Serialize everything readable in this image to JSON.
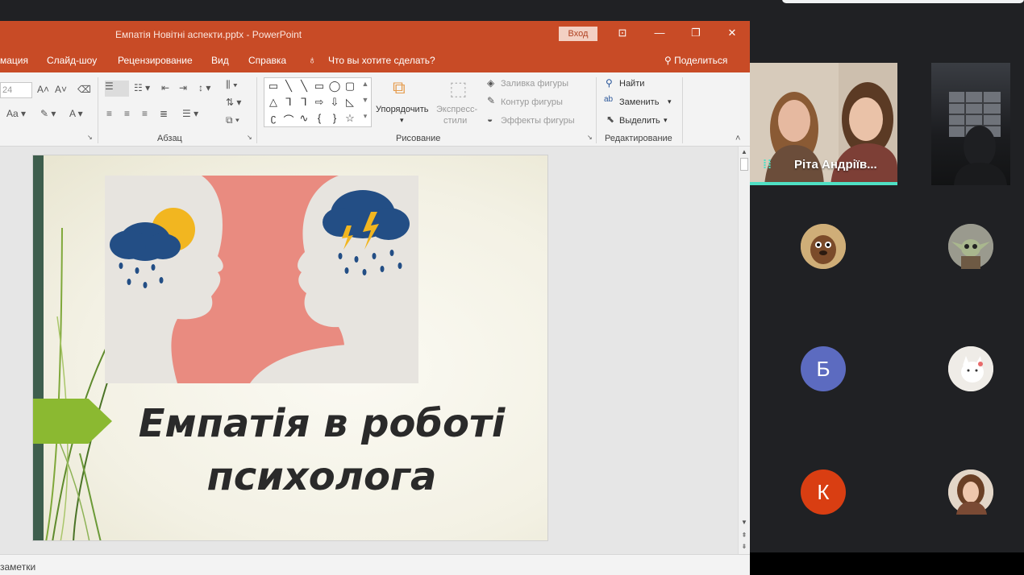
{
  "window": {
    "title": "Емпатія Новітні аспекти.pptx  -  PowerPoint",
    "login_label": "Вход"
  },
  "menu": {
    "items": [
      "мация",
      "Слайд-шоу",
      "Рецензирование",
      "Вид",
      "Справка"
    ],
    "tell_me": "Что вы хотите сделать?",
    "share": "Поделиться"
  },
  "ribbon": {
    "font_size": "24",
    "paragraph_label": "Абзац",
    "arrange_label": "Упорядочить",
    "quick_styles_line1": "Экспресс-",
    "quick_styles_line2": "стили",
    "shape_fill": "Заливка фигуры",
    "shape_outline": "Контур фигуры",
    "shape_effects": "Эффекты фигуры",
    "drawing_label": "Рисование",
    "find": "Найти",
    "replace": "Заменить",
    "select": "Выделить",
    "editing_label": "Редактирование"
  },
  "slide": {
    "title_line1": "Емпатія в роботі",
    "title_line2": "психолога"
  },
  "status": {
    "notes": "заметки"
  },
  "meet": {
    "speaker_name": "Ріта Андріїв...",
    "accent_color": "#4fe0c4",
    "participants": [
      {
        "type": "photo",
        "icon": "cartoon-dog-avatar"
      },
      {
        "type": "photo",
        "icon": "baby-yoda-avatar"
      },
      {
        "type": "letter",
        "letter": "Б",
        "color": "#5c6bc0"
      },
      {
        "type": "photo",
        "icon": "white-cat-avatar"
      },
      {
        "type": "letter",
        "letter": "К",
        "color": "#d93e12"
      },
      {
        "type": "photo",
        "icon": "girl-photo-avatar"
      }
    ]
  }
}
